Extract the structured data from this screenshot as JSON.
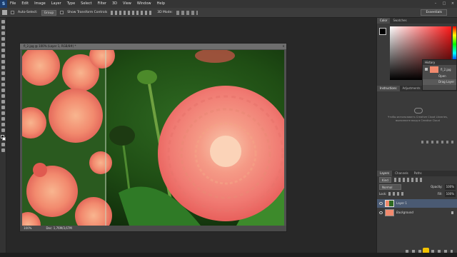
{
  "menubar": {
    "logo": "S",
    "items": [
      "File",
      "Edit",
      "Image",
      "Layer",
      "Type",
      "Select",
      "Filter",
      "3D",
      "View",
      "Window",
      "Help"
    ],
    "window_buttons": [
      "–",
      "□",
      "×"
    ]
  },
  "options": {
    "auto_select": "Auto-Select:",
    "group_value": "Group",
    "show_transform": "Show Transform Controls",
    "mode_3d": "3D Mode:",
    "essentials": "Essentials"
  },
  "document": {
    "title": "fl_2.jpg @ 100% (Layer 1, RGB/8#) *",
    "zoom": "100%",
    "doc_size": "Doc: 1,76M/3,67M"
  },
  "color_panel": {
    "tabs": [
      "Color",
      "Swatches"
    ]
  },
  "history": {
    "title": "History",
    "snapshot": "fl_2.jpg",
    "items": [
      "Open",
      "Drag Layer"
    ]
  },
  "adjust_panel": {
    "tabs": [
      "Instructions",
      "Adjustments"
    ],
    "cc_message": "Чтобы использовать Creative Cloud Libraries, выполните вход в Creative Cloud"
  },
  "layers_panel": {
    "tabs": [
      "Layers",
      "Channels",
      "Paths"
    ],
    "kind": "Kind",
    "blend": "Normal",
    "opacity_label": "Opacity:",
    "opacity": "100%",
    "lock_label": "Lock:",
    "fill_label": "Fill:",
    "fill": "100%",
    "layers": [
      "Layer 1",
      "Background"
    ]
  },
  "colors": {
    "ps_blue": "#1c3d6e",
    "selected_layer": "#4a5a73"
  }
}
